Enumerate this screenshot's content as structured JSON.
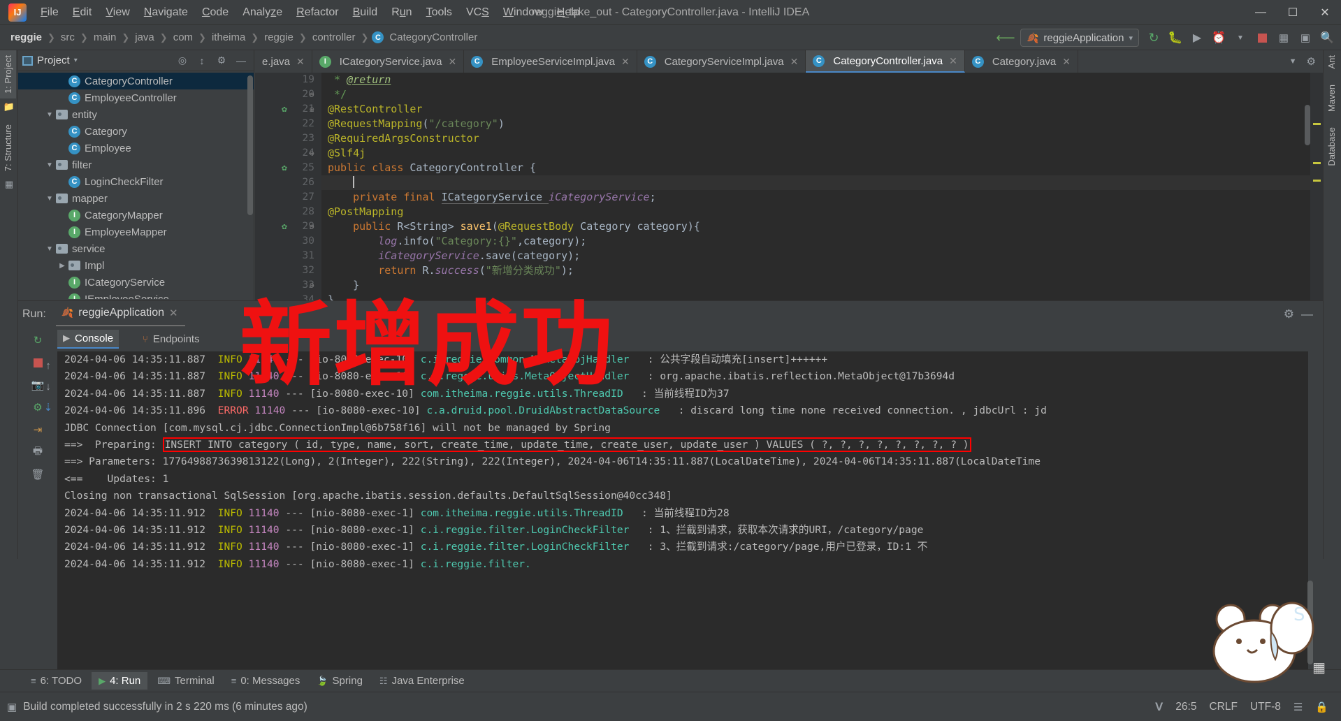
{
  "window": {
    "title": "reggie_take_out - CategoryController.java - IntelliJ IDEA",
    "minimize": "—",
    "maximize": "☐",
    "close": "✕"
  },
  "menu": [
    "File",
    "Edit",
    "View",
    "Navigate",
    "Code",
    "Analyze",
    "Refactor",
    "Build",
    "Run",
    "Tools",
    "VCS",
    "Window",
    "Help"
  ],
  "breadcrumb": {
    "items": [
      "reggie",
      "src",
      "main",
      "java",
      "com",
      "itheima",
      "reggie",
      "controller"
    ],
    "current": "CategoryController",
    "current_badge": "C",
    "separator": "›"
  },
  "toolbar": {
    "run_config": "reggieApplication",
    "dropdown_caret": "▾",
    "icons": [
      "build-hammer-icon",
      "run-icon",
      "debug-icon",
      "run-coverage-icon",
      "profile-icon",
      "stop-icon",
      "deploy-icon",
      "update-icon",
      "search-everywhere-icon"
    ]
  },
  "left_stripe": {
    "project": "1: Project",
    "structure": "7: Structure"
  },
  "right_stripe": {
    "ant": "Ant",
    "maven": "Maven",
    "database": "Database"
  },
  "project_panel": {
    "title": "Project",
    "dropdown_caret": "▾",
    "tree": [
      {
        "indent": 4,
        "type": "class",
        "label": "CategoryController",
        "selected": true,
        "twisty": ""
      },
      {
        "indent": 4,
        "type": "class",
        "label": "EmployeeController",
        "selected": false,
        "twisty": ""
      },
      {
        "indent": 3,
        "type": "folder",
        "label": "entity",
        "selected": false,
        "twisty": "▼"
      },
      {
        "indent": 4,
        "type": "class",
        "label": "Category",
        "selected": false,
        "twisty": ""
      },
      {
        "indent": 4,
        "type": "class",
        "label": "Employee",
        "selected": false,
        "twisty": ""
      },
      {
        "indent": 3,
        "type": "folder",
        "label": "filter",
        "selected": false,
        "twisty": "▼"
      },
      {
        "indent": 4,
        "type": "class",
        "label": "LoginCheckFilter",
        "selected": false,
        "twisty": ""
      },
      {
        "indent": 3,
        "type": "folder",
        "label": "mapper",
        "selected": false,
        "twisty": "▼"
      },
      {
        "indent": 4,
        "type": "interface",
        "label": "CategoryMapper",
        "selected": false,
        "twisty": ""
      },
      {
        "indent": 4,
        "type": "interface",
        "label": "EmployeeMapper",
        "selected": false,
        "twisty": ""
      },
      {
        "indent": 3,
        "type": "folder",
        "label": "service",
        "selected": false,
        "twisty": "▼"
      },
      {
        "indent": 4,
        "type": "folder",
        "label": "Impl",
        "selected": false,
        "twisty": "▶"
      },
      {
        "indent": 4,
        "type": "interface",
        "label": "ICategoryService",
        "selected": false,
        "twisty": ""
      },
      {
        "indent": 4,
        "type": "interface",
        "label": "IEmployeeService",
        "selected": false,
        "twisty": ""
      }
    ]
  },
  "editor_tabs": [
    {
      "label": "e.java",
      "type": "none",
      "active": false
    },
    {
      "label": "ICategoryService.java",
      "type": "interface",
      "active": false
    },
    {
      "label": "EmployeeServiceImpl.java",
      "type": "class",
      "active": false
    },
    {
      "label": "CategoryServiceImpl.java",
      "type": "class",
      "active": false
    },
    {
      "label": "CategoryController.java",
      "type": "class",
      "active": true
    },
    {
      "label": "Category.java",
      "type": "class",
      "active": false
    }
  ],
  "editor": {
    "lines": [
      {
        "num": "19",
        "marker": "",
        "fold": "",
        "text": " * @return",
        "kind": "javadoc-return"
      },
      {
        "num": "20",
        "marker": "",
        "fold": "⊖",
        "text": " */",
        "kind": "javadoc-end"
      },
      {
        "num": "21",
        "marker": "spring-bean-icon",
        "fold": "⊖",
        "text": "@RestController",
        "kind": "annotation"
      },
      {
        "num": "22",
        "marker": "",
        "fold": "",
        "text": "@RequestMapping(\"/category\")",
        "kind": "annotation-str"
      },
      {
        "num": "23",
        "marker": "",
        "fold": "",
        "text": "@RequiredArgsConstructor",
        "kind": "annotation"
      },
      {
        "num": "24",
        "marker": "",
        "fold": "⊖",
        "text": "@Slf4j",
        "kind": "annotation"
      },
      {
        "num": "25",
        "marker": "spring-bean-icon",
        "fold": "",
        "text": "public class CategoryController {",
        "kind": "class-decl"
      },
      {
        "num": "26",
        "marker": "",
        "fold": "",
        "text": "",
        "kind": "caret"
      },
      {
        "num": "27",
        "marker": "",
        "fold": "",
        "text": "private final ICategoryService iCategoryService;",
        "kind": "field"
      },
      {
        "num": "28",
        "marker": "",
        "fold": "",
        "text": "@PostMapping",
        "kind": "annotation"
      },
      {
        "num": "29",
        "marker": "spring-endpoint-icon",
        "fold": "⊖",
        "text": "public R<String> save1(@RequestBody Category category){",
        "kind": "method"
      },
      {
        "num": "30",
        "marker": "",
        "fold": "",
        "text": "log.info(\"Category:{}\",category);",
        "kind": "log"
      },
      {
        "num": "31",
        "marker": "",
        "fold": "",
        "text": "iCategoryService.save(category);",
        "kind": "call"
      },
      {
        "num": "32",
        "marker": "",
        "fold": "",
        "text": "return R.success(\"新增分类成功\");",
        "kind": "return"
      },
      {
        "num": "33",
        "marker": "",
        "fold": "⊖",
        "text": "}",
        "kind": "brace"
      },
      {
        "num": "34",
        "marker": "",
        "fold": "",
        "text": "}",
        "kind": "brace"
      }
    ]
  },
  "run_panel": {
    "label": "Run:",
    "config_name": "reggieApplication",
    "close_tab": "✕",
    "settings_icon": "gear-icon",
    "minimize_icon": "—",
    "subtabs": [
      {
        "label": "Console",
        "icon": "console-icon",
        "active": true
      },
      {
        "label": "Endpoints",
        "icon": "endpoints-icon",
        "active": false
      }
    ],
    "side_icons": [
      "rerun-icon",
      "scroll-up-icon",
      "stop-icon",
      "scroll-down-icon",
      "camera-icon",
      "thread-dump-icon",
      "soft-wrap-icon",
      "scroll-to-end-icon",
      "print-icon",
      "clear-all-icon"
    ],
    "console_lines": [
      {
        "date": "2024-04-06 14:35:11.887",
        "level": "INFO",
        "pid": "11140",
        "sep": "---",
        "thread": "[io-8080-exec-10]",
        "logger": "c.i.reggie.common.MyMetaObjHandler",
        "msg": ": 公共字段自动填充[insert]++++++"
      },
      {
        "date": "2024-04-06 14:35:11.887",
        "level": "INFO",
        "pid": "11140",
        "sep": "---",
        "thread": "[io-8080-exec-10]",
        "logger": "c.i.reggie.utils.MetaObjectHandler",
        "msg": ": org.apache.ibatis.reflection.MetaObject@17b3694d"
      },
      {
        "date": "2024-04-06 14:35:11.887",
        "level": "INFO",
        "pid": "11140",
        "sep": "---",
        "thread": "[io-8080-exec-10]",
        "logger": "com.itheima.reggie.utils.ThreadID",
        "msg": ": 当前线程ID为37"
      },
      {
        "date": "2024-04-06 14:35:11.896",
        "level": "ERROR",
        "pid": "11140",
        "sep": "---",
        "thread": "[io-8080-exec-10]",
        "logger": "c.a.druid.pool.DruidAbstractDataSource",
        "msg": ": discard long time none received connection. , jdbcUrl : jd"
      },
      {
        "raw": "JDBC Connection [com.mysql.cj.jdbc.ConnectionImpl@6b758f16] will not be managed by Spring"
      },
      {
        "sql_prefix": "==>  Preparing: ",
        "sql": "INSERT INTO category ( id, type, name, sort, create_time, update_time, create_user, update_user ) VALUES ( ?, ?, ?, ?, ?, ?, ?, ? )"
      },
      {
        "raw": "==> Parameters: 1776498873639813122(Long), 2(Integer), 222(String), 222(Integer), 2024-04-06T14:35:11.887(LocalDateTime), 2024-04-06T14:35:11.887(LocalDateTime"
      },
      {
        "raw": "<==    Updates: 1"
      },
      {
        "raw": "Closing non transactional SqlSession [org.apache.ibatis.session.defaults.DefaultSqlSession@40cc348]"
      },
      {
        "date": "2024-04-06 14:35:11.912",
        "level": "INFO",
        "pid": "11140",
        "sep": "---",
        "thread": "[nio-8080-exec-1]",
        "logger": "com.itheima.reggie.utils.ThreadID",
        "msg": ": 当前线程ID为28"
      },
      {
        "date": "2024-04-06 14:35:11.912",
        "level": "INFO",
        "pid": "11140",
        "sep": "---",
        "thread": "[nio-8080-exec-1]",
        "logger": "c.i.reggie.filter.LoginCheckFilter",
        "msg": ": 1、拦截到请求，获取本次请求的URI，/category/page"
      },
      {
        "date": "2024-04-06 14:35:11.912",
        "level": "INFO",
        "pid": "11140",
        "sep": "---",
        "thread": "[nio-8080-exec-1]",
        "logger": "c.i.reggie.filter.LoginCheckFilter",
        "msg": ": 3、拦截到请求:/category/page,用户已登录，ID:1 不"
      },
      {
        "date": "2024-04-06 14:35:11.912",
        "level": "INFO",
        "pid": "11140",
        "sep": "---",
        "thread": "[nio-8080-exec-1]",
        "logger": "c.i.reggie.filter.",
        "msg": ""
      }
    ]
  },
  "bottom_bar": [
    {
      "label": "6: TODO",
      "icon": "todo-icon",
      "active": false
    },
    {
      "label": "4: Run",
      "icon": "run-icon",
      "active": true
    },
    {
      "label": "Terminal",
      "icon": "terminal-icon",
      "active": false
    },
    {
      "label": "0: Messages",
      "icon": "messages-icon",
      "active": false
    },
    {
      "label": "Spring",
      "icon": "spring-leaf-icon",
      "active": false
    },
    {
      "label": "Java Enterprise",
      "icon": "java-enterprise-icon",
      "active": false
    }
  ],
  "status_bar": {
    "message": "Build completed successfully in 2 s 220 ms (6 minutes ago)",
    "caret_position": "26:5",
    "line_separator": "CRLF",
    "encoding": "UTF-8",
    "vcs_icon": "vcs-v-icon",
    "indent_icon": "indent-icon"
  },
  "watermark": {
    "text": "新增成功",
    "color": "#ef1111"
  }
}
